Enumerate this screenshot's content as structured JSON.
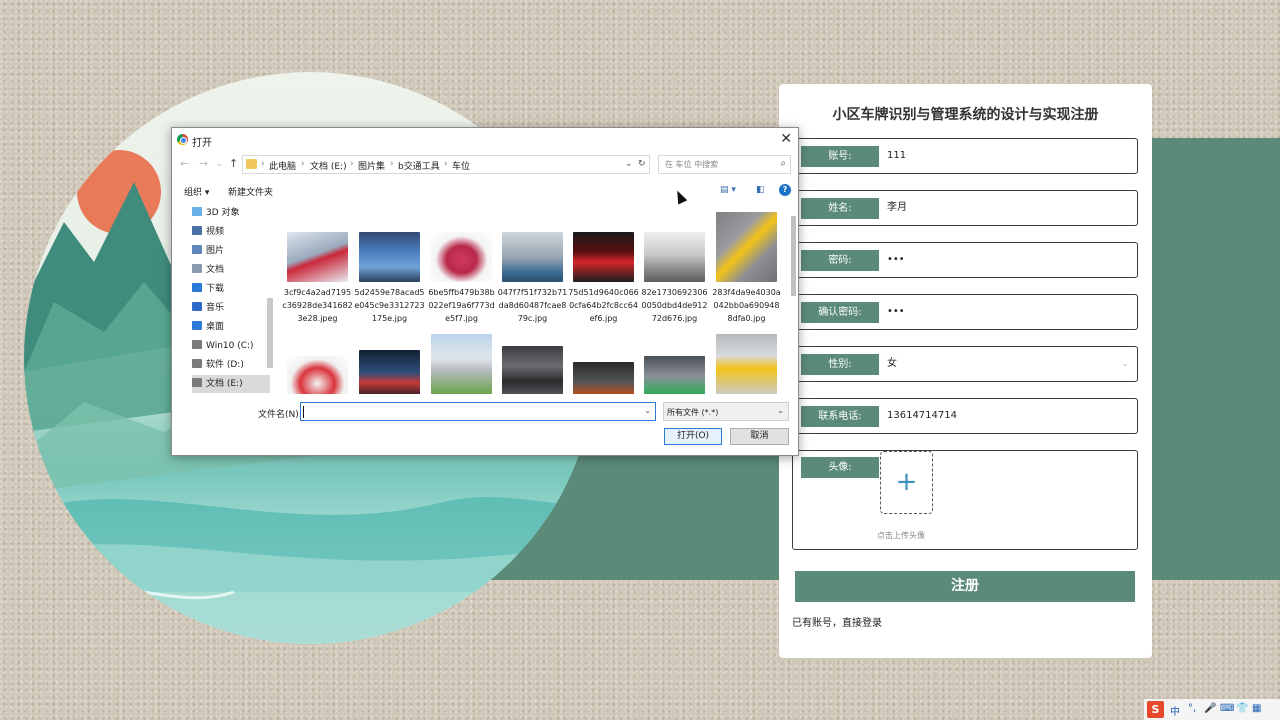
{
  "dialog": {
    "title": "打开",
    "breadcrumbs": [
      "此电脑",
      "文档 (E:)",
      "图片集",
      "b交通工具",
      "车位"
    ],
    "search_placeholder": "在 车位 中搜索",
    "toolbar": {
      "organize": "组织 ▾",
      "new_folder": "新建文件夹"
    },
    "nav_items": [
      {
        "label": "3D 对象",
        "icon": "cube-icon",
        "color": "#6ab0e6"
      },
      {
        "label": "视频",
        "icon": "video-icon",
        "color": "#4a6fa5"
      },
      {
        "label": "图片",
        "icon": "pictures-icon",
        "color": "#5c87b8"
      },
      {
        "label": "文档",
        "icon": "documents-icon",
        "color": "#8a9bb0"
      },
      {
        "label": "下载",
        "icon": "download-icon",
        "color": "#2a78d6"
      },
      {
        "label": "音乐",
        "icon": "music-icon",
        "color": "#2f6bc6"
      },
      {
        "label": "桌面",
        "icon": "desktop-icon",
        "color": "#2f7ad8"
      },
      {
        "label": "Win10 (C:)",
        "icon": "drive-icon",
        "color": "#7a7a7a"
      },
      {
        "label": "软件 (D:)",
        "icon": "drive-icon",
        "color": "#7a7a7a"
      },
      {
        "label": "文档 (E:)",
        "icon": "drive-icon",
        "color": "#7a7a7a"
      }
    ],
    "files": [
      {
        "name": "3cf9c4a2ad7195c36928de3416823e28.jpeg",
        "thumb": "linear-gradient(160deg,#dfe6ee 0%,#9aa9bd 45%,#c9283a 55%,#e7ecf2 100%)"
      },
      {
        "name": "5d2459e78acad5e045c9e3312723175e.jpg",
        "thumb": "linear-gradient(180deg,#314a73 0%,#4e7fc0 40%,#6fa3d8 70%,#2d3e5c 100%)"
      },
      {
        "name": "6be5ffb479b38b022ef19a6f773de5f7.jpg",
        "thumb": "radial-gradient(ellipse at 50% 55%,#d23a5e 0%,#b8294a 35%,#f4f4f4 60%,#ffffff 100%)"
      },
      {
        "name": "047f7f51f732b71da8d60487fcae879c.jpg",
        "thumb": "linear-gradient(180deg,#cfd6dc 0%,#9aa6b1 50%,#3e6e96 80%,#2c4e6d 100%)"
      },
      {
        "name": "75d51d9640c0660cfa64b2fc8cc64ef6.jpg",
        "thumb": "linear-gradient(180deg,#1a1a1a 0%,#5a1010 40%,#d3262a 60%,#1f1f1f 100%)"
      },
      {
        "name": "82e17306923060050dbd4de91272d676.jpg",
        "thumb": "linear-gradient(180deg,#eeeeee 0%,#c9c9c9 45%,#8a8a8a 75%,#5c5c5c 100%)"
      },
      {
        "name": "283f4da9e4030a042bb0a6909488dfa0.jpg",
        "thumb": "linear-gradient(135deg,#7d7f82 0%,#9a9c9f 35%,#f2c21a 50%,#8e9093 70%,#6d6f72 100%)"
      },
      {
        "name": "",
        "thumb": "radial-gradient(ellipse at 50% 55%,#f4f4f4 0%,#d9353b 40%,#f0f0f0 62%,#ffffff 100%)"
      },
      {
        "name": "",
        "thumb": "linear-gradient(180deg,#102033 0%,#2f4f7a 45%,#c33a3a 65%,#0e1622 100%)"
      },
      {
        "name": "",
        "thumb": "linear-gradient(180deg,#bcd4ec 0%,#e0e6ea 40%,#b8bcc0 60%,#6aa34b 100%)"
      },
      {
        "name": "",
        "thumb": "linear-gradient(180deg,#3b3d40 0%,#6a6c6f 40%,#2a2c2e 70%,#55575a 100%)"
      },
      {
        "name": "",
        "thumb": "linear-gradient(180deg,#2a2a2a 0%,#555555 40%,#b8501e 65%,#222222 100%)"
      },
      {
        "name": "",
        "thumb": "linear-gradient(180deg,#4a4f55 0%,#8a9096 40%,#3fa865 70%,#2f7e4d 100%)"
      },
      {
        "name": "",
        "thumb": "linear-gradient(180deg,#b6b9bc 0%,#d8dadc 35%,#f2c21a 55%,#c9cbcd 100%)"
      }
    ],
    "filename_label": "文件名(N):",
    "filename_value": "",
    "filter": "所有文件 (*.*)",
    "open_label": "打开(O)",
    "cancel_label": "取消"
  },
  "register": {
    "title": "小区车牌识别与管理系统的设计与实现注册",
    "fields": [
      {
        "label": "账号:",
        "value": "111"
      },
      {
        "label": "姓名:",
        "value": "李月"
      },
      {
        "label": "密码:",
        "value": "•••"
      },
      {
        "label": "确认密码:",
        "value": "•••"
      },
      {
        "label": "性别:",
        "value": "女"
      },
      {
        "label": "联系电话:",
        "value": "13614714714"
      }
    ],
    "avatar_label": "头像:",
    "upload_hint": "点击上传头像",
    "submit": "注册",
    "login_link": "已有账号，直接登录"
  },
  "colors": {
    "accent": "#5b8a78",
    "link_blue": "#2b79d0"
  },
  "tray": {
    "ime": "S",
    "lang": "中"
  }
}
